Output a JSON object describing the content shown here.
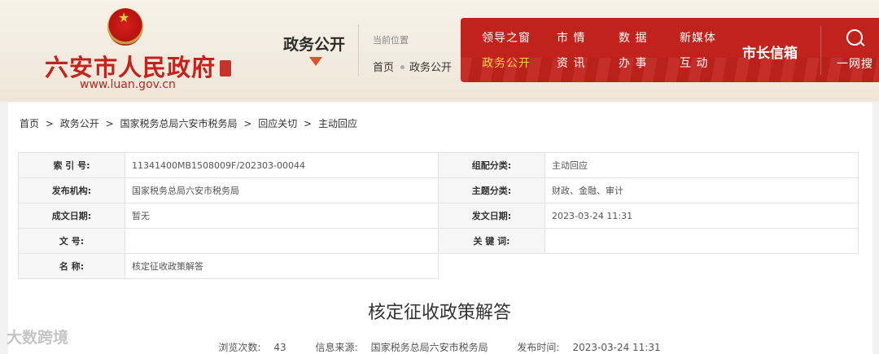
{
  "header": {
    "site_name": "六安市人民政府",
    "site_url": "www.luan.gov.cn",
    "channel": "政务公开",
    "location_label": "当前位置",
    "location_crumb": [
      "首页",
      "政务公开"
    ]
  },
  "nav": {
    "row1": [
      "领导之窗",
      "市 情",
      "数 据",
      "新媒体"
    ],
    "row2": [
      "政务公开",
      "资 讯",
      "办 事",
      "互 动"
    ],
    "mayor_box": "市长信箱",
    "search": "一网搜",
    "active": "政务公开",
    "accent": "#c2221c",
    "active_color": "#ffd24a"
  },
  "breadcrumb": [
    "首页",
    "政务公开",
    "国家税务总局六安市税务局",
    "回应关切",
    "主动回应"
  ],
  "breadcrumb_sep": ">",
  "meta": {
    "index_no": {
      "label": "索 引 号:",
      "value": "11341400MB1508009F/202303-00044"
    },
    "category": {
      "label": "组配分类:",
      "value": "主动回应"
    },
    "publisher": {
      "label": "发布机构:",
      "value": "国家税务总局六安市税务局"
    },
    "topic": {
      "label": "主题分类:",
      "value": "财政、金融、审计"
    },
    "created": {
      "label": "成文日期:",
      "value": "暂无"
    },
    "published": {
      "label": "发文日期:",
      "value": "2023-03-24 11:31"
    },
    "doc_no": {
      "label": "文 号:",
      "value": ""
    },
    "keywords": {
      "label": "关 键 词:",
      "value": ""
    },
    "name": {
      "label": "名 称:",
      "value": "核定征收政策解答"
    }
  },
  "article": {
    "title": "核定征收政策解答",
    "views_label": "浏览次数:",
    "views": "43",
    "source_label": "信息来源:",
    "source": "国家税务总局六安市税务局",
    "time_label": "发布时间:",
    "time": "2023-03-24 11:31"
  },
  "watermark": "大数跨境"
}
